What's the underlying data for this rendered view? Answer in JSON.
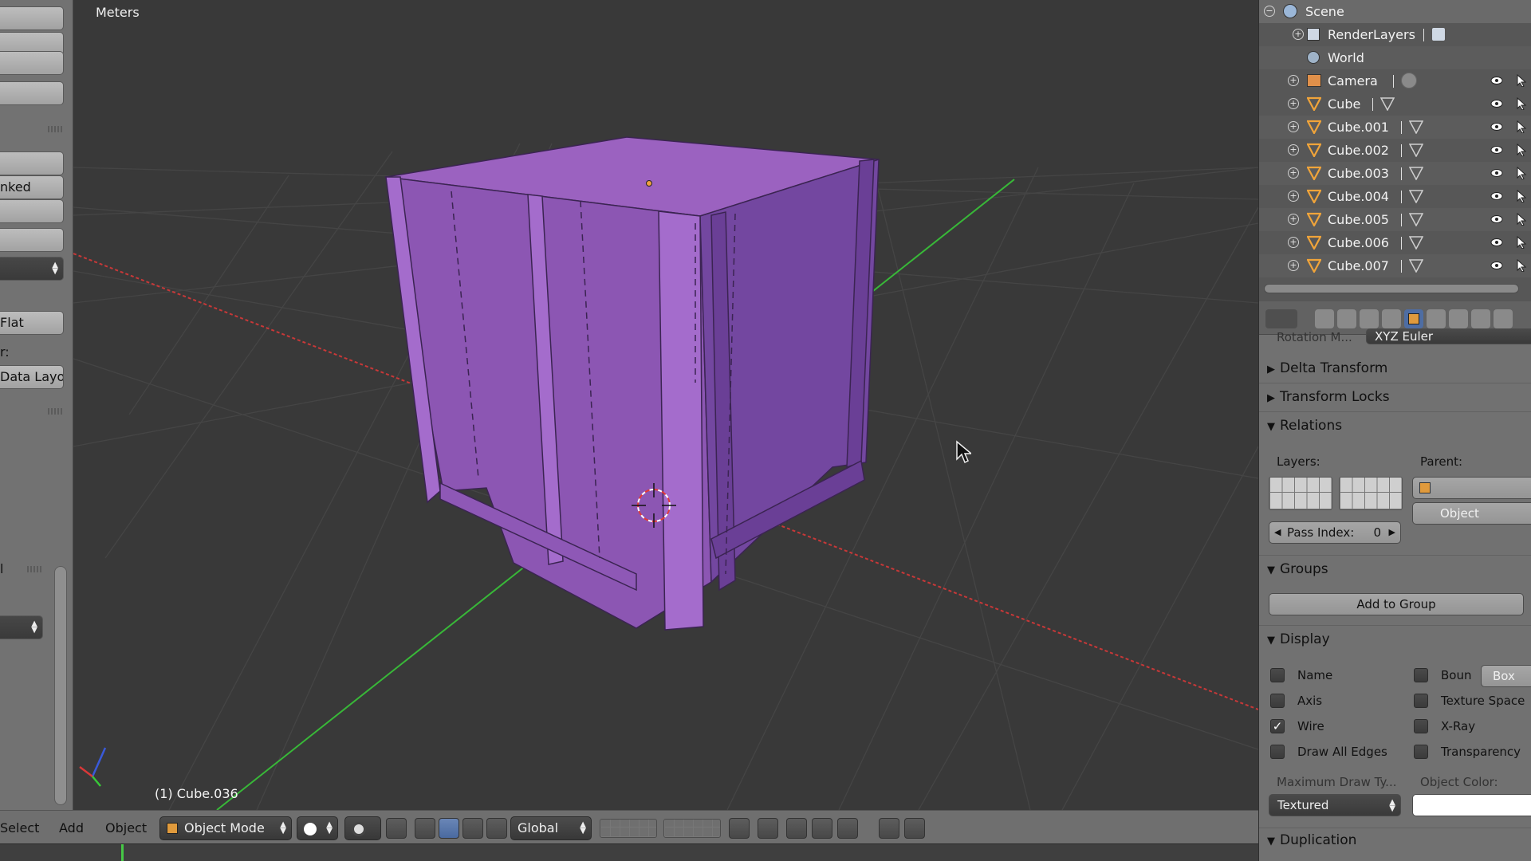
{
  "toolshelf": {
    "texts": [
      "nked",
      "Flat",
      "r:",
      "Data Layo",
      "l"
    ]
  },
  "viewport": {
    "units_label": "Meters",
    "object_label": "(1) Cube.036"
  },
  "header": {
    "menu_select": "Select",
    "menu_add": "Add",
    "menu_object": "Object",
    "mode": "Object Mode",
    "orientation": "Global"
  },
  "outliner": {
    "items": [
      {
        "label": "Scene",
        "icon": "scene-icon"
      },
      {
        "label": "RenderLayers",
        "icon": "render-layers-icon"
      },
      {
        "label": "World",
        "icon": "world-icon"
      },
      {
        "label": "Camera",
        "icon": "camera-icon"
      },
      {
        "label": "Cube",
        "icon": "mesh-icon"
      },
      {
        "label": "Cube.001",
        "icon": "mesh-icon"
      },
      {
        "label": "Cube.002",
        "icon": "mesh-icon"
      },
      {
        "label": "Cube.003",
        "icon": "mesh-icon"
      },
      {
        "label": "Cube.004",
        "icon": "mesh-icon"
      },
      {
        "label": "Cube.005",
        "icon": "mesh-icon"
      },
      {
        "label": "Cube.006",
        "icon": "mesh-icon"
      },
      {
        "label": "Cube.007",
        "icon": "mesh-icon"
      }
    ]
  },
  "properties": {
    "rotation_mode_label": "Rotation M...",
    "rotation_mode_value": "XYZ Euler",
    "sections": {
      "delta_transform": "Delta Transform",
      "transform_locks": "Transform Locks",
      "relations": "Relations",
      "groups": "Groups",
      "display": "Display",
      "duplication": "Duplication"
    },
    "relations": {
      "layers_label": "Layers:",
      "parent_label": "Parent:",
      "parent_type": "Object",
      "pass_index_label": "Pass Index:",
      "pass_index_value": "0"
    },
    "groups": {
      "add_to_group": "Add to Group"
    },
    "display": {
      "name": "Name",
      "axis": "Axis",
      "wire": "Wire",
      "draw_all_edges": "Draw All Edges",
      "bounds": "Boun",
      "bounds_type": "Box",
      "texture_space": "Texture Space",
      "xray": "X-Ray",
      "transparency": "Transparency",
      "max_draw_type_label": "Maximum Draw Ty...",
      "max_draw_type_value": "Textured",
      "object_color_label": "Object Color:",
      "wire_checked": true
    }
  },
  "colors": {
    "cube": "#9b62c0",
    "x_axis": "#c83838",
    "y_axis": "#38b838",
    "active_tab": "#4e6da3"
  }
}
